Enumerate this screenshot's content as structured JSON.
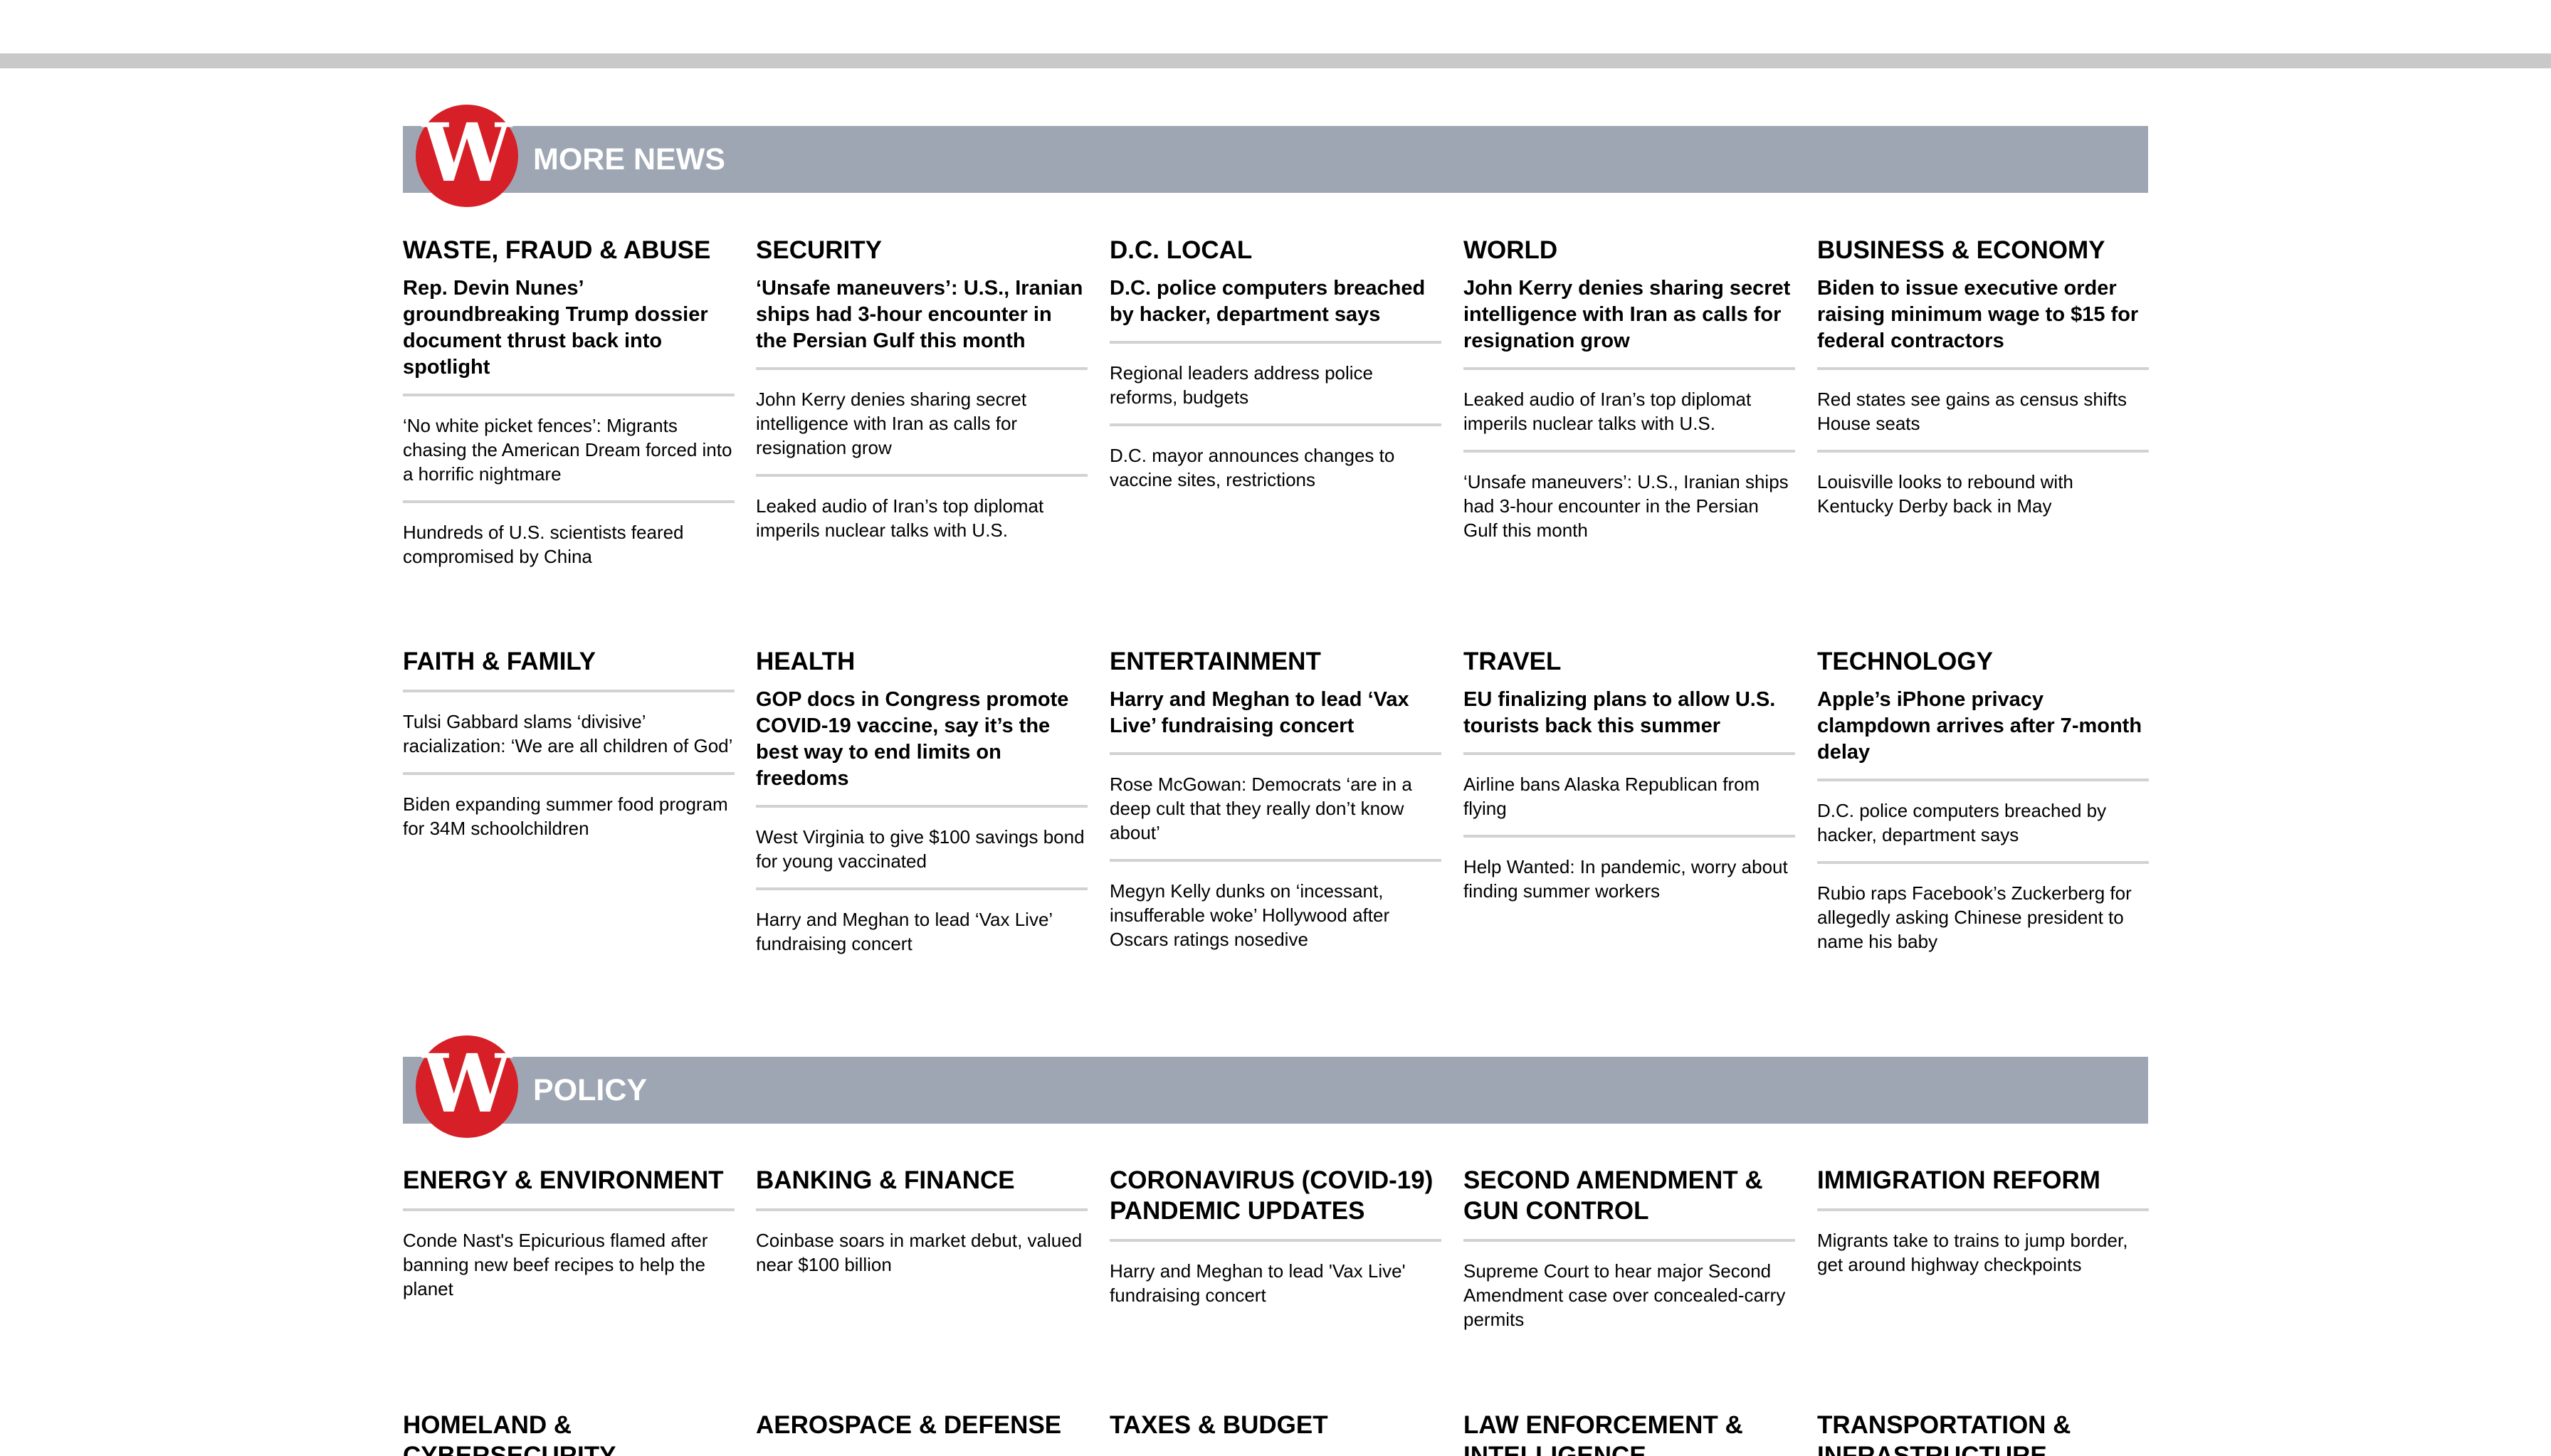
{
  "more_news": {
    "title": "MORE NEWS",
    "logo_letter": "W",
    "rows": [
      [
        {
          "category": "WASTE, FRAUD & ABUSE",
          "lead": "Rep. Devin Nunes’ groundbreaking Trump dossier document thrust back into spotlight",
          "items": [
            "‘No white picket fences’: Migrants chasing the American Dream forced into a horrific nightmare",
            "Hundreds of U.S. scientists feared compromised by China"
          ]
        },
        {
          "category": "SECURITY",
          "lead": "‘Unsafe maneuvers’: U.S., Iranian ships had 3-hour encounter in the Persian Gulf this month",
          "items": [
            "John Kerry denies sharing secret intelligence with Iran as calls for resignation grow",
            "Leaked audio of Iran’s top diplomat imperils nuclear talks with U.S."
          ]
        },
        {
          "category": "D.C. LOCAL",
          "lead": "D.C. police computers breached by hacker, department says",
          "items": [
            "Regional leaders address police reforms, budgets",
            "D.C. mayor announces changes to vaccine sites, restrictions"
          ]
        },
        {
          "category": "WORLD",
          "lead": "John Kerry denies sharing secret intelligence with Iran as calls for resignation grow",
          "items": [
            "Leaked audio of Iran’s top diplomat imperils nuclear talks with U.S.",
            "‘Unsafe maneuvers’: U.S., Iranian ships had 3-hour encounter in the Persian Gulf this month"
          ]
        },
        {
          "category": "BUSINESS & ECONOMY",
          "lead": "Biden to issue executive order raising minimum wage to $15 for federal contractors",
          "items": [
            "Red states see gains as census shifts House seats",
            "Louisville looks to rebound with Kentucky Derby back in May"
          ]
        }
      ],
      [
        {
          "category": "FAITH & FAMILY",
          "lead": "",
          "items": [
            "Tulsi Gabbard slams ‘divisive’ racialization: ‘We are all children of God’",
            "Biden expanding summer food program for 34M schoolchildren"
          ]
        },
        {
          "category": "HEALTH",
          "lead": "GOP docs in Congress promote COVID-19 vaccine, say it’s the best way to end limits on freedoms",
          "items": [
            "West Virginia to give $100 savings bond for young vaccinated",
            "Harry and Meghan to lead ‘Vax Live’ fundraising concert"
          ]
        },
        {
          "category": "ENTERTAINMENT",
          "lead": "Harry and Meghan to lead ‘Vax Live’ fundraising concert",
          "items": [
            "Rose McGowan: Democrats ‘are in a deep cult that they really don’t know about’",
            "Megyn Kelly dunks on ‘incessant, insufferable woke’ Hollywood after Oscars ratings nosedive"
          ]
        },
        {
          "category": "TRAVEL",
          "lead": "EU finalizing plans to allow U.S. tourists back this summer",
          "items": [
            "Airline bans Alaska Republican from flying",
            "Help Wanted: In pandemic, worry about finding summer workers"
          ]
        },
        {
          "category": "TECHNOLOGY",
          "lead": "Apple’s iPhone privacy clampdown arrives after 7-month delay",
          "items": [
            "D.C. police computers breached by hacker, department says",
            "Rubio raps Facebook’s Zuckerberg for allegedly asking Chinese president to name his baby"
          ]
        }
      ]
    ]
  },
  "policy": {
    "title": "POLICY",
    "logo_letter": "W",
    "rows": [
      [
        {
          "category": "ENERGY & ENVIRONMENT",
          "items": [
            "Conde Nast's Epicurious flamed after banning new beef recipes to help the planet"
          ]
        },
        {
          "category": "BANKING & FINANCE",
          "items": [
            "Coinbase soars in market debut, valued near $100 billion"
          ]
        },
        {
          "category": "CORONAVIRUS (COVID-19) PANDEMIC UPDATES",
          "items": [
            "Harry and Meghan to lead 'Vax Live' fundraising concert"
          ]
        },
        {
          "category": "SECOND AMENDMENT & GUN CONTROL",
          "items": [
            "Supreme Court to hear major Second Amendment case over concealed-carry permits"
          ]
        },
        {
          "category": "IMMIGRATION REFORM",
          "items": [
            "Migrants take to trains to jump border, get around highway checkpoints"
          ]
        }
      ],
      [
        {
          "category": "HOMELAND & CYBERSECURITY",
          "items": []
        },
        {
          "category": "AEROSPACE & DEFENSE",
          "items": []
        },
        {
          "category": "TAXES & BUDGET",
          "items": []
        },
        {
          "category": "LAW ENFORCEMENT & INTELLIGENCE",
          "items": []
        },
        {
          "category": "TRANSPORTATION & INFRASTRUCTURE",
          "items": []
        }
      ]
    ]
  },
  "colors": {
    "header_bg": "#9ea6b4",
    "logo_red": "#d61f26",
    "divider": "#d2d2d2",
    "top_bar": "#c9c9c9"
  }
}
